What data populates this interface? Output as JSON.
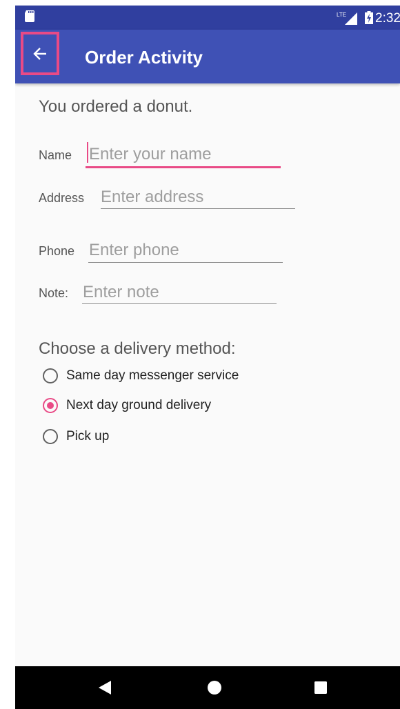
{
  "status_bar": {
    "network": "LTE",
    "time": "2:32"
  },
  "app_bar": {
    "title": "Order Activity",
    "back_icon": "arrow-left-icon"
  },
  "main": {
    "intro": "You ordered a donut.",
    "fields": [
      {
        "label": "Name",
        "placeholder": "Enter your name",
        "value": ""
      },
      {
        "label": "Address",
        "placeholder": "Enter address",
        "value": ""
      },
      {
        "label": "Phone",
        "placeholder": "Enter phone",
        "value": ""
      },
      {
        "label": "Note:",
        "placeholder": "Enter note",
        "value": ""
      }
    ],
    "delivery_heading": "Choose a delivery method:",
    "delivery_options": [
      {
        "label": "Same day messenger service",
        "checked": false
      },
      {
        "label": "Next day ground delivery",
        "checked": true
      },
      {
        "label": "Pick up",
        "checked": false
      }
    ]
  },
  "colors": {
    "primary": "#3f51b5",
    "primary_dark": "#303f9f",
    "accent": "#e94a86"
  },
  "nav_bar": {
    "back_icon": "triangle-back-icon",
    "home_icon": "circle-home-icon",
    "recents_icon": "square-recents-icon"
  }
}
